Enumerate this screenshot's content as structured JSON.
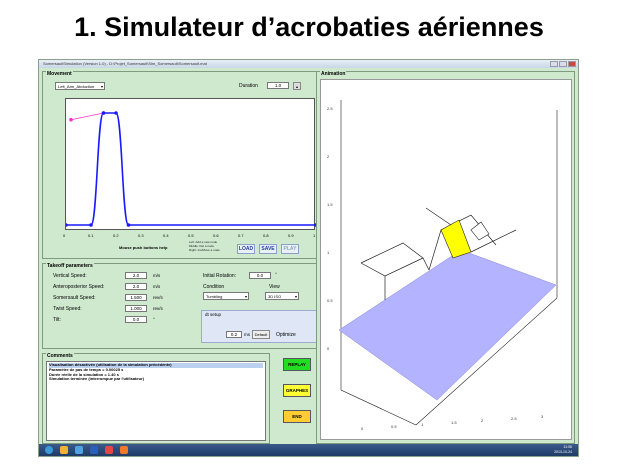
{
  "slide": {
    "title": "1. Simulateur d’acrobaties aériennes"
  },
  "window": {
    "title": "SomersaultSimulation (Version 1.0) - D:\\Projet_Somersault\\Sim_Somersault\\Somersault.mat"
  },
  "movement": {
    "title": "Movement",
    "selected": "Left_Arm_Abduction",
    "duration_label": "Duration",
    "duration_value": "1.0",
    "x_ticks": [
      "0",
      "0.1",
      "0.2",
      "0.3",
      "0.4",
      "0.5",
      "0.6",
      "0.7",
      "0.8",
      "0.9",
      "1"
    ],
    "hint": "Mouse push buttons help",
    "note_lines": [
      "Left: Add a new node",
      "Middle: Del a node",
      "Right: Ins/Move a node"
    ],
    "side_buttons": [
      "⤒",
      "≡",
      "V"
    ],
    "load_label": "LOAD",
    "save_label": "SAVE",
    "play_label": "PLAY",
    "curve_nodes": [
      {
        "t": 0.0,
        "v": 0.0
      },
      {
        "t": 0.1,
        "v": 0.0
      },
      {
        "t": 0.15,
        "v": 1.0
      },
      {
        "t": 0.2,
        "v": 1.0
      },
      {
        "t": 0.25,
        "v": 0.0
      },
      {
        "t": 1.0,
        "v": 0.0
      }
    ],
    "magenta_nodes": [
      {
        "t": 0.02,
        "v": 0.94
      },
      {
        "t": 0.15,
        "v": 1.0
      }
    ],
    "colors": {
      "curve": "#1a1aff",
      "magenta": "#ff33cc"
    }
  },
  "takeoff": {
    "title": "Takeoff parameters",
    "fields": [
      {
        "label": "Vertical Speed:",
        "value": "2.0",
        "unit": "m/s"
      },
      {
        "label": "Anteroposterior Speed:",
        "value": "2.0",
        "unit": "m/s"
      },
      {
        "label": "Somersault Speed:",
        "value": "1.500",
        "unit": "rev/s"
      },
      {
        "label": "Twist Speed:",
        "value": "1.000",
        "unit": "rev/s"
      },
      {
        "label": "Tilt:",
        "value": "0.0",
        "unit": "°"
      }
    ],
    "initial_rotation_label": "Initial Rotation:",
    "initial_rotation_value": "0.0",
    "initial_rotation_unit": "°",
    "condition_label": "Condition",
    "condition_value": "Tumbling",
    "view_label": "View",
    "view_value": "3D ISO",
    "dt_title": "dt setup",
    "dt_value": "0.2",
    "dt_unit": "ms",
    "default_label": "Default",
    "optimize_label": "Optimize"
  },
  "comments": {
    "title": "Comments",
    "lines": [
      "Visualisation désactivée (utilisation de la simulation précédente)",
      "Paramètre de pas de temps = 0.00025 s",
      "Durée réelle de la simulation = 1.40 s",
      "Simulation terminée (interrompue par l'utilisateur)"
    ]
  },
  "actions": {
    "replay_label": "REPLAY",
    "graphes_label": "GRAPHES",
    "end_label": "END",
    "colors": {
      "replay": "#22dd22",
      "graphes": "#ffff33",
      "end": "#ffcc33"
    }
  },
  "animation": {
    "title": "Animation",
    "y_ticks": [
      "2.5",
      "2",
      "1.5",
      "1",
      "0.5",
      "0"
    ],
    "x_ticks": [
      "0",
      "0.5",
      "1",
      "1.5",
      "2",
      "2.5",
      "3"
    ],
    "colors": {
      "floor": "#b3b3ff",
      "body": "#ffff00"
    }
  },
  "taskbar": {
    "time": "11:06",
    "date": "2013-10-24",
    "icon_colors": [
      "#3a9ad9",
      "#f2b134",
      "#4fa3e0",
      "#2b5fb8",
      "#e04848",
      "#f07a2a"
    ]
  }
}
